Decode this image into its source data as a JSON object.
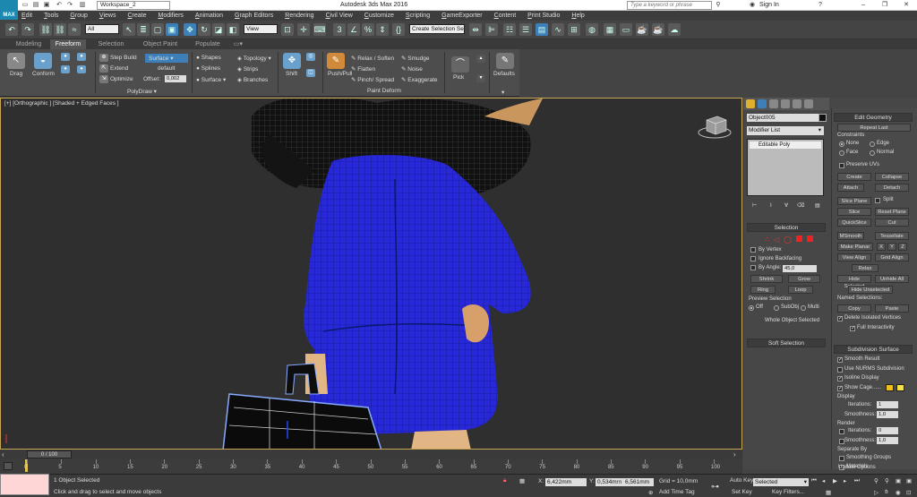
{
  "app": {
    "title": "Autodesk 3ds Max 2016",
    "logo_text": "MAX",
    "workspace": "Workspace_2",
    "search_placeholder": "Type a keyword or phrase",
    "sign_in": "Sign In"
  },
  "menu": [
    "Edit",
    "Tools",
    "Group",
    "Views",
    "Create",
    "Modifiers",
    "Animation",
    "Graph Editors",
    "Rendering",
    "Civil View",
    "Customize",
    "Scripting",
    "GameExporter",
    "Content",
    "Print Studio",
    "Help"
  ],
  "toolbar": {
    "filter": "All",
    "ref_coord": "View",
    "selection_set": "Create Selection Se"
  },
  "ribbon_tabs": [
    "Modeling",
    "Freeform",
    "Selection",
    "Object Paint",
    "Populate"
  ],
  "active_ribbon_tab": "Freeform",
  "ribbon": {
    "drag": "Drag",
    "conform": "Conform",
    "step_build": "Step Build",
    "extend": "Extend",
    "optimize": "Optimize",
    "surface_dd": "Surface",
    "default": "default",
    "offset_label": "Offset:",
    "offset_value": "0,002",
    "shapes": "Shapes",
    "splines": "Splines",
    "surface": "Surface",
    "topology": "Topology",
    "strips": "Strips",
    "branches": "Branches",
    "polydraw": "PolyDraw",
    "shift": "Shift",
    "push_pull": "Push/Pull",
    "relax_soften": "Relax / Soften",
    "flatten": "Flatten",
    "pinch_spread": "Pinch/ Spread",
    "smudge": "Smudge",
    "noise": "Noise",
    "exaggerate": "Exaggerate",
    "paint_deform": "Paint Deform",
    "pick": "Pick",
    "defaults": "Defaults"
  },
  "viewport": {
    "label": "[+] [Orthographic ] [Shaded + Edged Faces ]"
  },
  "command_panel": {
    "object_name": "Object005",
    "modifier_list": "Modifier List",
    "stack_item": "Editable Poly",
    "selection": {
      "header": "Selection",
      "by_vertex": "By Vertex",
      "ignore_backfacing": "Ignore Backfacing",
      "by_angle": "By Angle:",
      "angle_value": "45,0",
      "shrink": "Shrink",
      "grow": "Grow",
      "ring": "Ring",
      "loop": "Loop",
      "preview": "Preview Selection",
      "off": "Off",
      "subobj": "SubObj",
      "multi": "Multi",
      "status": "Whole Object Selected"
    },
    "soft_selection": "Soft Selection",
    "edit_geometry": {
      "header": "Edit Geometry",
      "repeat_last": "Repeat Last",
      "constraints": "Constraints",
      "none": "None",
      "edge": "Edge",
      "face": "Face",
      "normal": "Normal",
      "preserve_uvs": "Preserve UVs",
      "create": "Create",
      "collapse": "Collapse",
      "attach": "Attach",
      "detach": "Detach",
      "slice_plane": "Slice Plane",
      "split": "Split",
      "slice": "Slice",
      "reset_plane": "Reset Plane",
      "quickslice": "QuickSlice",
      "cut": "Cut",
      "msmooth": "MSmooth",
      "tessellate": "Tessellate",
      "make_planar": "Make Planar",
      "x": "X",
      "y": "Y",
      "z": "Z",
      "view_align": "View Align",
      "grid_align": "Grid Align",
      "relax": "Relax",
      "hide_selected": "Hide Selected",
      "unhide_all": "Unhide All",
      "hide_unselected": "Hide Unselected",
      "named_selections": "Named Selections:",
      "copy": "Copy",
      "paste": "Paste",
      "delete_isolated": "Delete Isolated Vertices",
      "full_interactivity": "Full Interactivity"
    },
    "subdivision": {
      "header": "Subdivision Surface",
      "smooth_result": "Smooth Result",
      "use_nurms": "Use NURMS Subdivision",
      "isoline": "Isoline Display",
      "show_cage": "Show Cage......",
      "display": "Display",
      "iterations": "Iterations:",
      "iter_val": "1",
      "smoothness": "Smoothness:",
      "smooth_val": "1,0",
      "render": "Render",
      "r_iter_val": "0",
      "r_smooth_val": "1,0",
      "separate_by": "Separate By",
      "smoothing_groups": "Smoothing Groups",
      "materials": "Materials",
      "update_options": "Update Options"
    },
    "cage_colors": [
      "#f2c01b",
      "#f4e04a"
    ]
  },
  "timeline": {
    "frame": "0 / 100",
    "ticks": [
      "0",
      "5",
      "10",
      "15",
      "20",
      "25",
      "30",
      "35",
      "40",
      "45",
      "50",
      "55",
      "60",
      "65",
      "70",
      "75",
      "80",
      "85",
      "90",
      "95",
      "100"
    ]
  },
  "status": {
    "selected": "1 Object Selected",
    "prompt": "Click and drag to select and move objects",
    "x_label": "X:",
    "x": "6,422mm",
    "y_label": "Y:",
    "y": "0,534mm",
    "z_label": "Z:",
    "z": "6,561mm",
    "grid": "Grid = 10,0mm",
    "add_time_tag": "Add Time Tag",
    "auto_key": "Auto Key",
    "set_key": "Set Key",
    "selected_dd": "Selected",
    "key_filters": "Key Filters..."
  }
}
